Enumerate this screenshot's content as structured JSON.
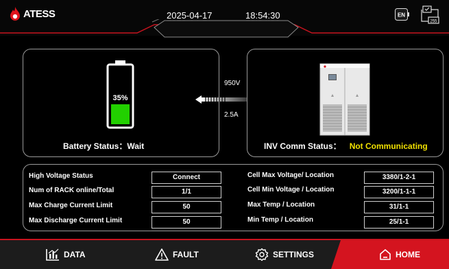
{
  "header": {
    "logo_text": "ATESS",
    "date": "2025-04-17",
    "time": "18:54:30",
    "lang_badge": "EN",
    "net_badge": "255"
  },
  "battery": {
    "percent_label": "35%",
    "level_fraction": 0.35,
    "status_label": "Battery Status：",
    "status_value": "Wait",
    "fill_color": "#22d000"
  },
  "flow": {
    "voltage": "950V",
    "current": "2.5A"
  },
  "inverter": {
    "status_label": "INV Comm Status：",
    "status_value": "Not Communicating",
    "status_color": "#f0e000"
  },
  "info": {
    "left": [
      {
        "label": "High Voltage Status",
        "value": "Connect"
      },
      {
        "label": "Num of RACK online/Total",
        "value": "1/1"
      },
      {
        "label": "Max Charge Current Limit",
        "value": "50"
      },
      {
        "label": "Max Discharge Current Limit",
        "value": "50"
      }
    ],
    "right": [
      {
        "label": "Cell Max Voltage/ Location",
        "value": "3380/1-2-1"
      },
      {
        "label": "Cell Min Voltage / Location",
        "value": "3200/1-1-1"
      },
      {
        "label": "Max Temp / Location",
        "value": "31/1-1"
      },
      {
        "label": "Min Temp / Location",
        "value": "25/1-1"
      }
    ]
  },
  "nav": {
    "data": "DATA",
    "fault": "FAULT",
    "settings": "SETTINGS",
    "home": "HOME",
    "active_color": "#d4141f",
    "icons": [
      "chart-icon",
      "warning-icon",
      "gear-icon",
      "home-icon"
    ]
  }
}
